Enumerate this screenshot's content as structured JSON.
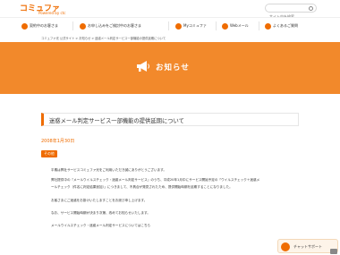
{
  "header": {
    "logo_main": "コミュファ",
    "logo_sub": "Powered by ctc",
    "search_placeholder": "サイト内を検索"
  },
  "nav": {
    "items": [
      {
        "label": "契約中のお客さま"
      },
      {
        "label": "お申し込みをご検討中のお客さま"
      },
      {
        "label": "Myコミュファ"
      },
      {
        "label": "Webメール"
      },
      {
        "label": "よくあるご質問"
      }
    ]
  },
  "breadcrumb": "コミュファ光 公式サイト > お知らせ > 迷惑メール判定サービス一部機能の提供延期について",
  "banner": {
    "title": "お知らせ"
  },
  "article": {
    "title": "迷惑メール判定サービス一部機能の提供延期について",
    "date": "2008年1月30日",
    "badge": "その他",
    "lines": [
      "平素は弊社サービスコミュファ光をご利用いただき誠にありがとうございます。",
      "弊社提供中の『メールウイルスチェック・迷惑メール判定サービス』のうち、平成20年1月中にサービス開始予定の「ウイルスチェック＋迷惑メ",
      "ールチェック（件名に判定結果追加）」につきまして、不具合が発見されたため、提供開始時期を延期することになりました。",
      "お客さまにご迷惑をお掛けいたしますことをお詫び申し上げます。",
      "なお、サービス開始時期が決まり次第、改めてお知らせいたします。",
      "メールウイルスチェック・迷惑メール判定サービスについてはこちら"
    ]
  },
  "chat": {
    "label": "チャットサポート"
  },
  "colors": {
    "accent": "#ef6c00",
    "banner": "#f2892b"
  }
}
